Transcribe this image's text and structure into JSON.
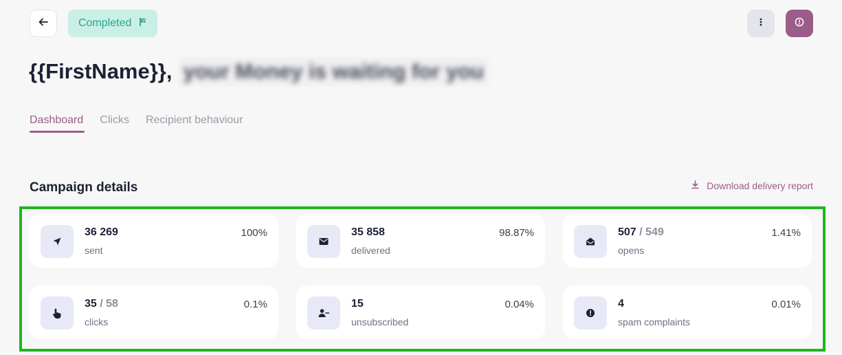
{
  "header": {
    "status_label": "Completed",
    "status_icon": "flag-icon",
    "back_icon": "arrow-left-icon",
    "more_icon": "more-vertical-icon",
    "info_icon": "info-circle-icon"
  },
  "campaign": {
    "title_prefix": "{{FirstName}},",
    "title_rest": "your Money is waiting for you"
  },
  "tabs": [
    {
      "label": "Dashboard",
      "active": true
    },
    {
      "label": "Clicks",
      "active": false
    },
    {
      "label": "Recipient behaviour",
      "active": false
    }
  ],
  "section": {
    "title": "Campaign details",
    "download_label": "Download delivery report",
    "download_icon": "download-icon"
  },
  "stats": [
    {
      "icon": "send-icon",
      "value": "36 269",
      "total": "",
      "label": "sent",
      "percent": "100%"
    },
    {
      "icon": "mail-icon",
      "value": "35 858",
      "total": "",
      "label": "delivered",
      "percent": "98.87%"
    },
    {
      "icon": "mail-open-icon",
      "value": "507",
      "total": "549",
      "label": "opens",
      "percent": "1.41%"
    },
    {
      "icon": "pointer-hand-icon",
      "value": "35",
      "total": "58",
      "label": "clicks",
      "percent": "0.1%"
    },
    {
      "icon": "user-minus-icon",
      "value": "15",
      "total": "",
      "label": "unsubscribed",
      "percent": "0.04%"
    },
    {
      "icon": "alert-circle-icon",
      "value": "4",
      "total": "",
      "label": "spam complaints",
      "percent": "0.01%"
    }
  ],
  "colors": {
    "accent": "#9a5d8a",
    "status_bg": "#c9efe6",
    "status_text": "#2ca48a",
    "highlight": "#1fb61f",
    "icon_bg": "#e7e9f6"
  }
}
